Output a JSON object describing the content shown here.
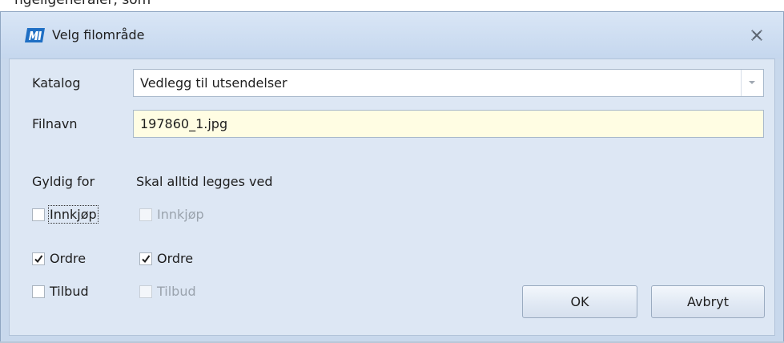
{
  "background_text": "ngeligeneraler, som",
  "window": {
    "title": "Velg filområde",
    "logo_icon": "app-logo-icon",
    "close_icon": "close-icon"
  },
  "form": {
    "katalog_label": "Katalog",
    "katalog_value": "Vedlegg til utsendelser",
    "filnavn_label": "Filnavn",
    "filnavn_value": "197860_1.jpg"
  },
  "gyldig_for": {
    "heading": "Gyldig for",
    "items": [
      {
        "label": "Innkjøp",
        "checked": false,
        "enabled": true,
        "focused": true
      },
      {
        "label": "Ordre",
        "checked": true,
        "enabled": true,
        "focused": false
      },
      {
        "label": "Tilbud",
        "checked": false,
        "enabled": true,
        "focused": false
      }
    ]
  },
  "skal_alltid": {
    "heading": "Skal alltid legges ved",
    "items": [
      {
        "label": "Innkjøp",
        "checked": false,
        "enabled": false
      },
      {
        "label": "Ordre",
        "checked": true,
        "enabled": true
      },
      {
        "label": "Tilbud",
        "checked": false,
        "enabled": false
      }
    ]
  },
  "buttons": {
    "ok": "OK",
    "cancel": "Avbryt"
  },
  "colors": {
    "dialog_bg": "#c8d8ec",
    "client_bg": "#dde7f4",
    "input_highlight": "#fffde3",
    "logo": "#1f6fc4"
  }
}
